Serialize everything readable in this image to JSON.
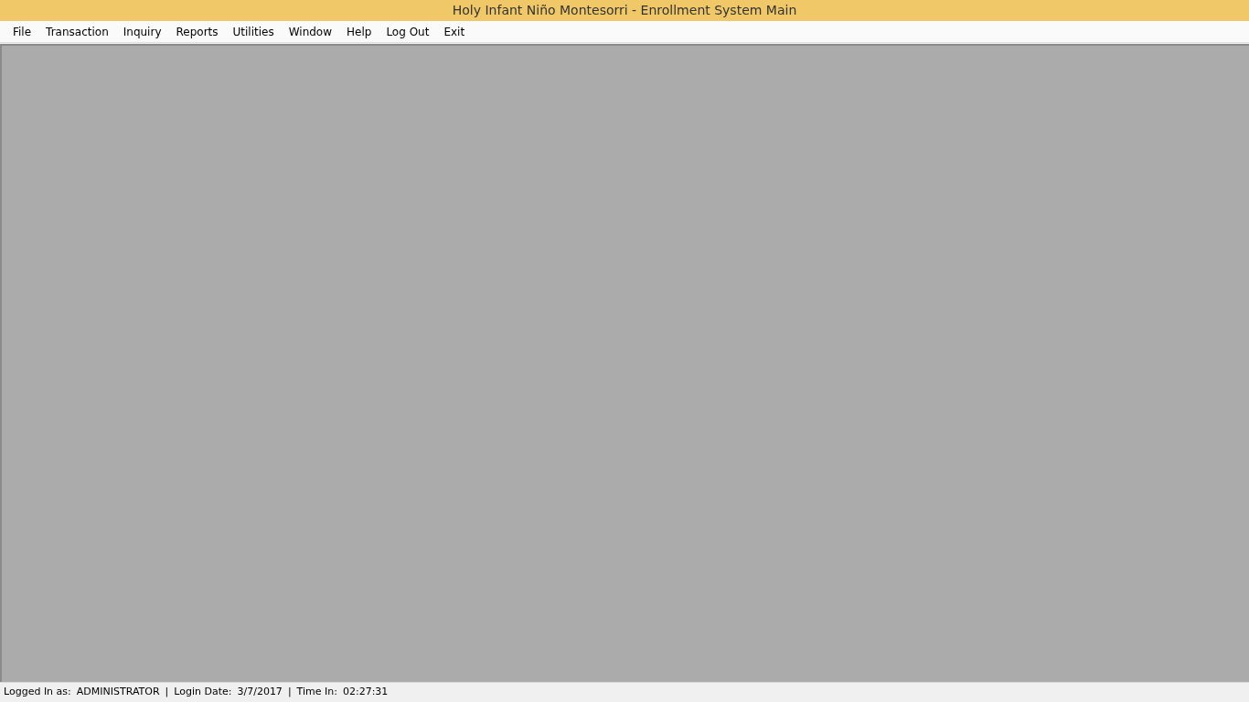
{
  "window": {
    "title": "Holy Infant Niño Montesorri - Enrollment System Main"
  },
  "menu": [
    "File",
    "Transaction",
    "Inquiry",
    "Reports",
    "Utilities",
    "Window",
    "Help",
    "Log Out",
    "Exit"
  ],
  "status_bar": [
    {
      "kind": "field",
      "label": "Logged In as:",
      "value": "ADMINISTRATOR"
    },
    {
      "kind": "separator",
      "text": "|"
    },
    {
      "kind": "field",
      "label": "Login Date:",
      "value": "3/7/2017"
    },
    {
      "kind": "separator",
      "text": "|"
    },
    {
      "kind": "field",
      "label": "Time In:",
      "value": "02:27:31"
    }
  ]
}
